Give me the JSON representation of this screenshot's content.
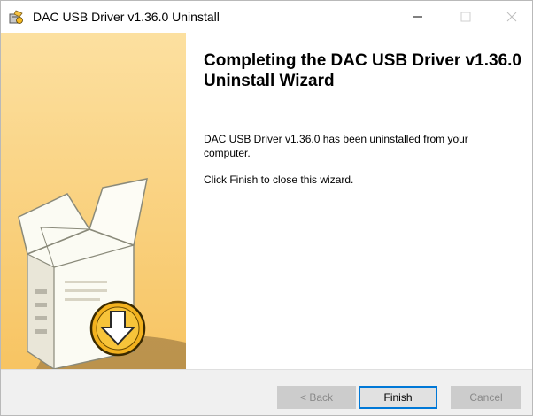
{
  "window": {
    "title": "DAC USB Driver v1.36.0 Uninstall",
    "icons": [
      "app-icon",
      "minimize-icon",
      "maximize-icon",
      "close-icon"
    ]
  },
  "main": {
    "heading": "Completing the DAC USB Driver v1.36.0 Uninstall Wizard",
    "message1": "DAC USB Driver v1.36.0 has been uninstalled from your computer.",
    "message2": "Click Finish to close this wizard."
  },
  "buttons": {
    "back": "< Back",
    "finish": "Finish",
    "cancel": "Cancel"
  },
  "colors": {
    "sidebar": "#fbd88a",
    "focus": "#0078d7"
  }
}
